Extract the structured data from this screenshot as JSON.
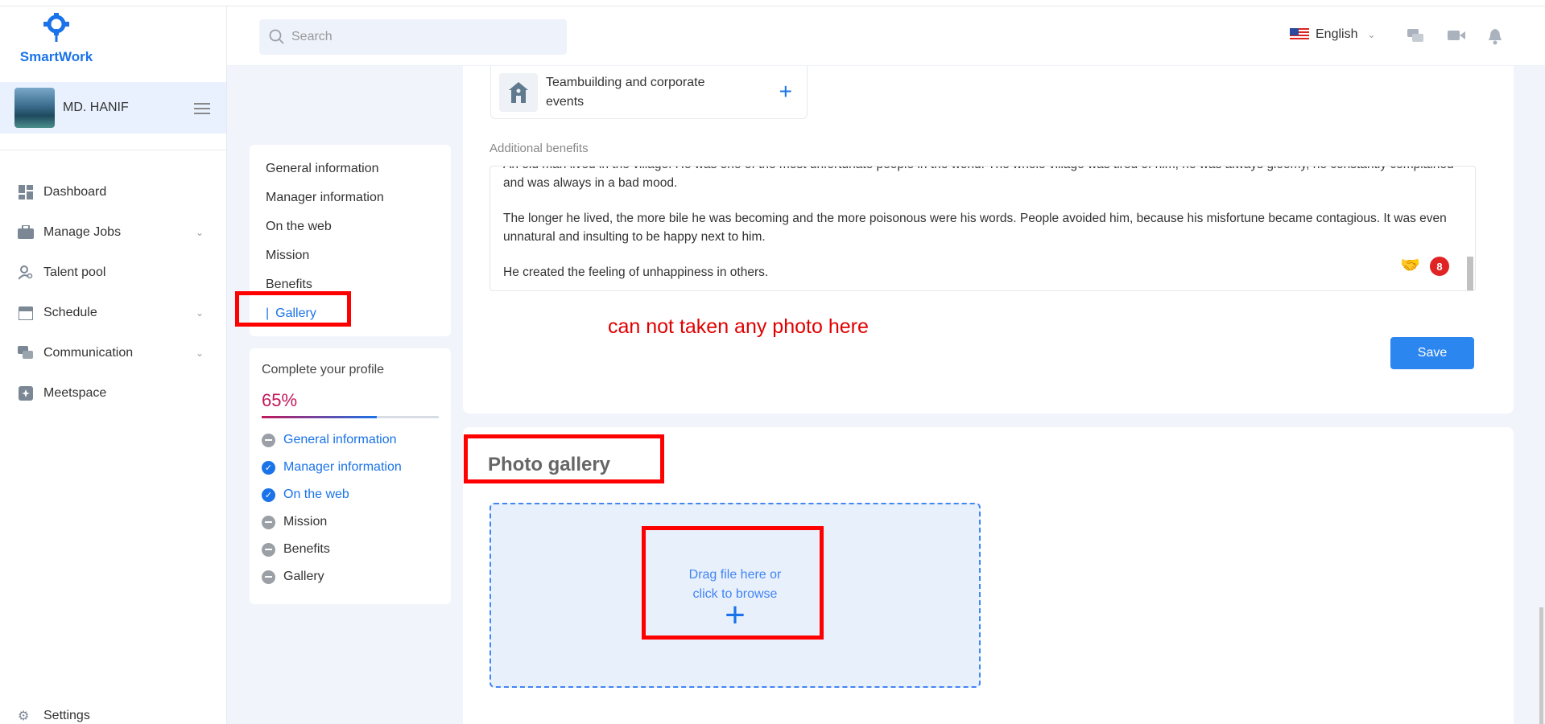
{
  "app": {
    "brand": "SmartWork"
  },
  "user": {
    "name": "MD. HANIF"
  },
  "sidebar": {
    "items": [
      {
        "label": "Dashboard",
        "icon": "dashboard-icon",
        "has_children": false
      },
      {
        "label": "Manage Jobs",
        "icon": "briefcase-icon",
        "has_children": true
      },
      {
        "label": "Talent pool",
        "icon": "person-search-icon",
        "has_children": false
      },
      {
        "label": "Schedule",
        "icon": "calendar-icon",
        "has_children": true
      },
      {
        "label": "Communication",
        "icon": "chat-icon",
        "has_children": true
      },
      {
        "label": "Meetspace",
        "icon": "meetspace-icon",
        "has_children": false
      }
    ],
    "settings_label": "Settings"
  },
  "header": {
    "search_placeholder": "Search",
    "language": "English"
  },
  "subnav": {
    "items": [
      {
        "label": "General information"
      },
      {
        "label": "Manager information"
      },
      {
        "label": "On the web"
      },
      {
        "label": "Mission"
      },
      {
        "label": "Benefits"
      },
      {
        "label": "Gallery"
      }
    ],
    "active": "Gallery"
  },
  "profile": {
    "title": "Complete your profile",
    "percent_label": "65%",
    "progress": 0.65,
    "steps": [
      {
        "label": "General information",
        "done": false,
        "link": true
      },
      {
        "label": "Manager information",
        "done": true,
        "link": true
      },
      {
        "label": "On the web",
        "done": true,
        "link": true
      },
      {
        "label": "Mission",
        "done": false,
        "link": false
      },
      {
        "label": "Benefits",
        "done": false,
        "link": false
      },
      {
        "label": "Gallery",
        "done": false,
        "link": false
      }
    ]
  },
  "benefits": {
    "card_label": "Teambuilding and corporate events",
    "additional_label": "Additional benefits",
    "text_lines": [
      "An old man lived in the village. He was one of the most unfortunate people in the world. The whole village was tired of him, he was always gloomy, he constantly complained and was always in a bad mood.",
      "The longer he lived, the more bile he was becoming and the more poisonous were his words. People avoided him, because his misfortune became contagious. It was even unnatural and insulting to be happy next to him.",
      "He created the feeling of unhappiness in others."
    ],
    "badge_count": "8",
    "save_label": "Save"
  },
  "annotation": {
    "note": "can not taken any photo here"
  },
  "gallery": {
    "title": "Photo gallery",
    "drop_line1": "Drag file here or",
    "drop_line2": "click to browse"
  }
}
